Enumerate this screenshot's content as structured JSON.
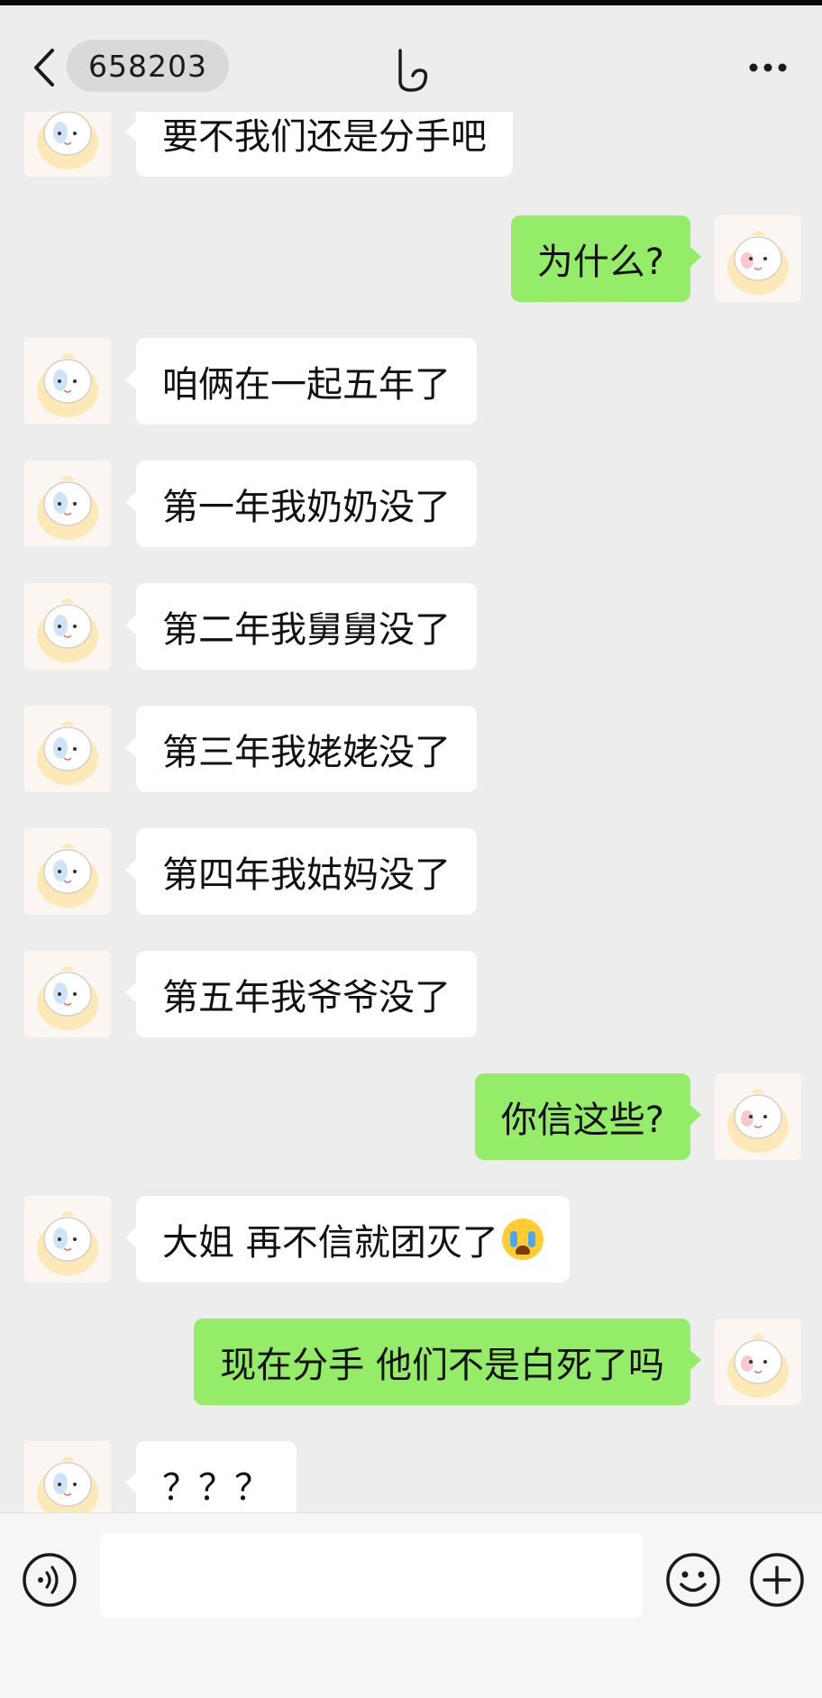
{
  "header": {
    "contact_name": "658203"
  },
  "messages": [
    {
      "side": "left",
      "text": "要不我们还是分手吧"
    },
    {
      "side": "right",
      "text": "为什么?"
    },
    {
      "side": "left",
      "text": "咱俩在一起五年了"
    },
    {
      "side": "left",
      "text": "第一年我奶奶没了"
    },
    {
      "side": "left",
      "text": "第二年我舅舅没了"
    },
    {
      "side": "left",
      "text": "第三年我姥姥没了"
    },
    {
      "side": "left",
      "text": "第四年我姑妈没了"
    },
    {
      "side": "left",
      "text": "第五年我爷爷没了"
    },
    {
      "side": "right",
      "text": "你信这些?"
    },
    {
      "side": "left",
      "text": "大姐 再不信就团灭了",
      "emoji": "loudly-crying-face"
    },
    {
      "side": "right",
      "text": "现在分手 他们不是白死了吗"
    },
    {
      "side": "left",
      "text": "？？？"
    }
  ],
  "colors": {
    "background": "#ededed",
    "bubble_left": "#ffffff",
    "bubble_right": "#95ec69",
    "input_bar": "#f6f6f6"
  },
  "icons": {
    "back": "chevron-left-icon",
    "title": "hand-icon",
    "more": "more-dots-icon",
    "voice": "voice-icon",
    "emoji": "smiley-icon",
    "add": "plus-icon"
  }
}
